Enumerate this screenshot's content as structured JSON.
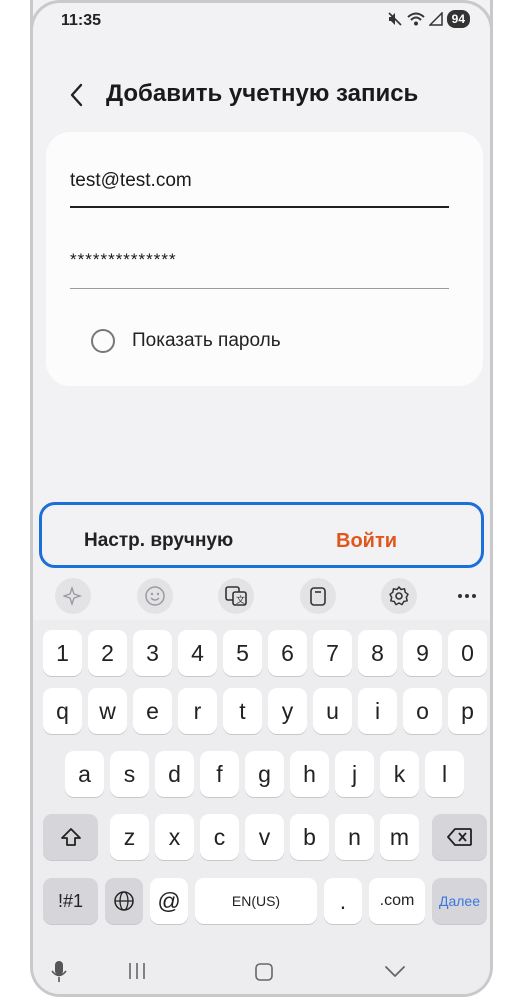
{
  "status_bar": {
    "time": "11:35",
    "battery": "94",
    "icons": [
      "mute-icon",
      "wifi-icon",
      "signal-icon"
    ]
  },
  "header": {
    "title": "Добавить учетную запись",
    "back_icon": "back-arrow-icon"
  },
  "form": {
    "email_value": "test@test.com",
    "password_value": "**************",
    "show_password_label": "Показать пароль",
    "show_password_checked": false
  },
  "actions": {
    "manual_label": "Настр. вручную",
    "login_label": "Войти",
    "login_color": "#e0571e",
    "focus_color": "#1a6fd8"
  },
  "keyboard_toolbar": [
    "sparkle-icon",
    "emoji-icon",
    "translate-icon",
    "clipboard-icon",
    "settings-icon",
    "more-icon"
  ],
  "keyboard": {
    "row_numbers": [
      "1",
      "2",
      "3",
      "4",
      "5",
      "6",
      "7",
      "8",
      "9",
      "0"
    ],
    "row_1": [
      "q",
      "w",
      "e",
      "r",
      "t",
      "y",
      "u",
      "i",
      "o",
      "p"
    ],
    "row_2": [
      "a",
      "s",
      "d",
      "f",
      "g",
      "h",
      "j",
      "k",
      "l"
    ],
    "row_3": [
      "z",
      "x",
      "c",
      "v",
      "b",
      "n",
      "m"
    ],
    "symbols_label": "!#1",
    "at_label": "@",
    "space_label": "EN(US)",
    "dot_label": ".",
    "com_label": ".com",
    "next_label": "Далее"
  },
  "nav_bar": [
    "mic-icon",
    "recents-icon",
    "home-icon",
    "back-icon"
  ]
}
